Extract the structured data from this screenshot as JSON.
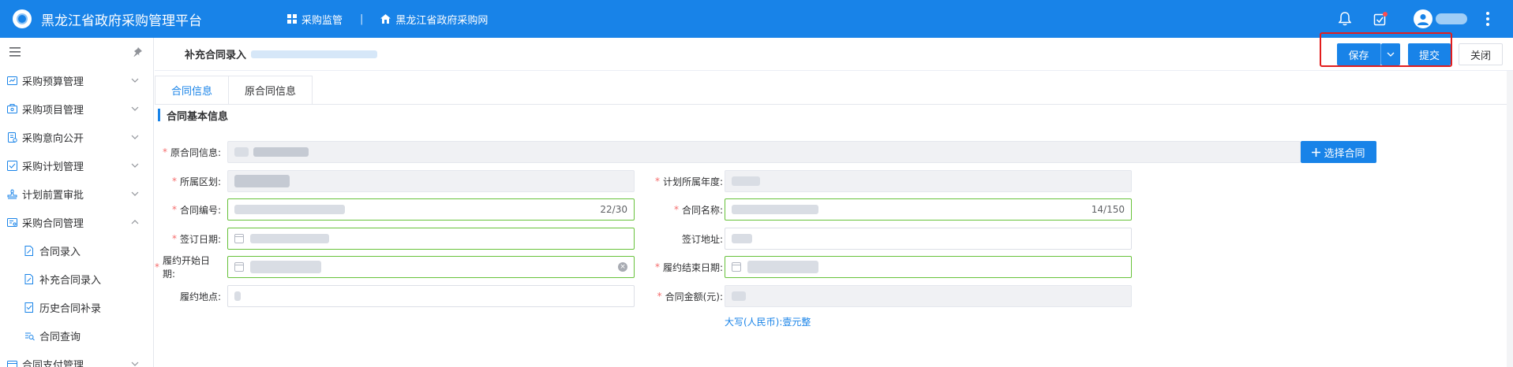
{
  "header": {
    "app_title": "黑龙江省政府采购管理平台",
    "nav": [
      {
        "label": "采购监管",
        "icon": "grid-icon"
      },
      {
        "label": "黑龙江省政府采购网",
        "icon": "home-icon"
      }
    ],
    "icons": [
      "bell-icon",
      "task-icon",
      "user-avatar-icon",
      "more-vertical-icon"
    ]
  },
  "sidebar": {
    "items": [
      {
        "label": "采购预算管理",
        "icon": "budget-icon",
        "expanded": false
      },
      {
        "label": "采购项目管理",
        "icon": "project-icon",
        "expanded": false
      },
      {
        "label": "采购意向公开",
        "icon": "announce-icon",
        "expanded": false
      },
      {
        "label": "采购计划管理",
        "icon": "plan-icon",
        "expanded": false
      },
      {
        "label": "计划前置审批",
        "icon": "approval-icon",
        "expanded": false
      },
      {
        "label": "采购合同管理",
        "icon": "contract-icon",
        "expanded": true
      }
    ],
    "subitems": [
      {
        "label": "合同录入",
        "icon": "doc-edit-icon"
      },
      {
        "label": "补充合同录入",
        "icon": "doc-edit-icon"
      },
      {
        "label": "历史合同补录",
        "icon": "doc-check-icon"
      },
      {
        "label": "合同查询",
        "icon": "doc-search-icon"
      }
    ],
    "cut_item": {
      "label": "合同支付管理"
    }
  },
  "page": {
    "title": "补充合同录入",
    "actions": {
      "save": "保存",
      "submit": "提交",
      "close": "关闭"
    },
    "tabs": [
      {
        "label": "合同信息",
        "active": true
      },
      {
        "label": "原合同信息",
        "active": false
      }
    ],
    "section_title": "合同基本信息",
    "form": {
      "orig_contract": {
        "label": "原合同信息:",
        "required": true,
        "button": "选择合同"
      },
      "region": {
        "label": "所属区划:",
        "required": true
      },
      "plan_year": {
        "label": "计划所属年度:",
        "required": true
      },
      "contract_no": {
        "label": "合同编号:",
        "required": true,
        "counter": "22/30"
      },
      "contract_name": {
        "label": "合同名称:",
        "required": true,
        "counter": "14/150"
      },
      "sign_date": {
        "label": "签订日期:",
        "required": true
      },
      "sign_place": {
        "label": "签订地址:",
        "required": false
      },
      "start_date": {
        "label": "履约开始日期:",
        "required": true
      },
      "end_date": {
        "label": "履约结束日期:",
        "required": true
      },
      "perform_place": {
        "label": "履约地点:",
        "required": false
      },
      "amount": {
        "label": "合同金额(元):",
        "required": true,
        "capital": "大写(人民币):壹元整"
      }
    }
  },
  "colors": {
    "primary": "#1883e8",
    "required": "#f56c6c",
    "valid": "#67c23a",
    "highlight": "#e21d1d"
  }
}
